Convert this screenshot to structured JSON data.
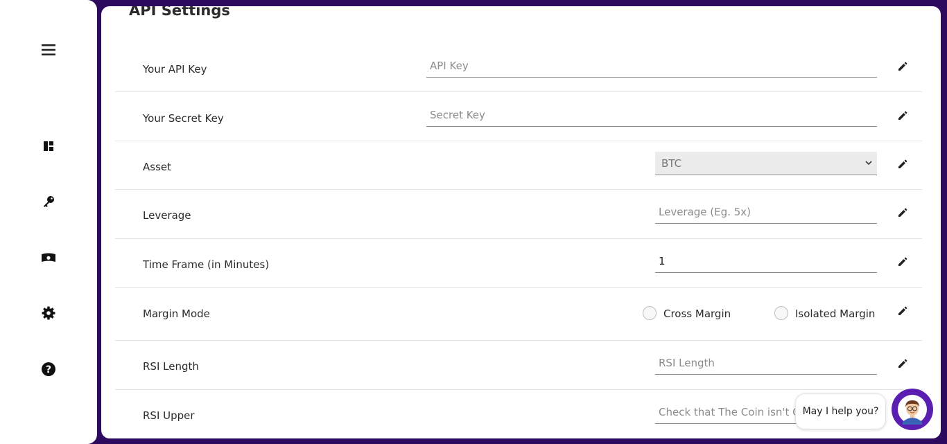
{
  "page": {
    "title": "API Settings"
  },
  "sidebar": {
    "items": [
      {
        "icon": "menu-icon"
      },
      {
        "icon": "dashboard-icon"
      },
      {
        "icon": "key-icon"
      },
      {
        "icon": "money-icon"
      },
      {
        "icon": "gear-icon"
      },
      {
        "icon": "help-icon"
      }
    ]
  },
  "settings": {
    "api_key": {
      "label": "Your API Key",
      "placeholder": "API Key",
      "value": ""
    },
    "secret_key": {
      "label": "Your Secret Key",
      "placeholder": "Secret Key",
      "value": ""
    },
    "asset": {
      "label": "Asset",
      "selected": "BTC"
    },
    "leverage": {
      "label": "Leverage",
      "placeholder": "Leverage (Eg. 5x)",
      "value": ""
    },
    "time_frame": {
      "label": "Time Frame (in Minutes)",
      "value": "1"
    },
    "margin_mode": {
      "label": "Margin Mode",
      "option_cross": "Cross Margin",
      "option_isolated": "Isolated Margin"
    },
    "rsi_length": {
      "label": "RSI Length",
      "placeholder": "RSI Length",
      "value": ""
    },
    "rsi_upper": {
      "label": "RSI Upper",
      "placeholder": "Check that The Coin isn't O",
      "value": ""
    }
  },
  "chat": {
    "bubble_text": "May I help you?"
  },
  "colors": {
    "background": "#2d0a5e",
    "chat_accent": "#5a1fb0"
  }
}
